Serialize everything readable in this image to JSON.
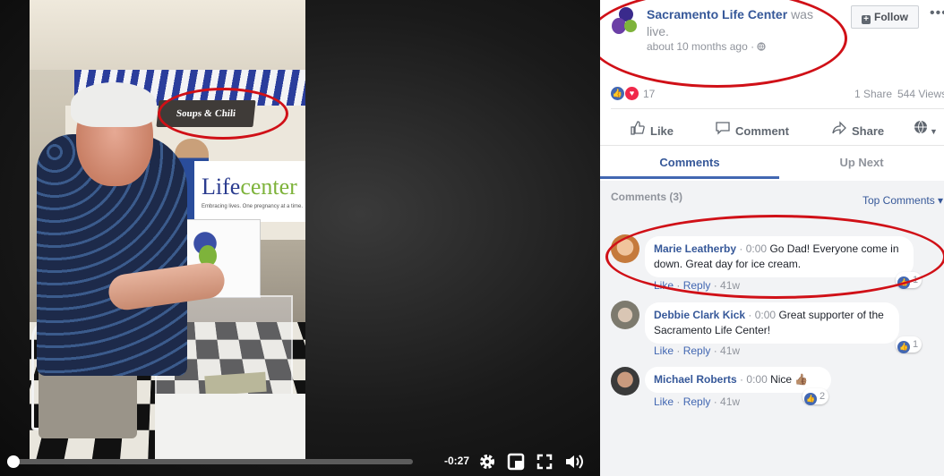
{
  "video": {
    "scene_text": {
      "store_sign": "Soups & Chili",
      "banner_logo_a": "Life",
      "banner_logo_b": "center",
      "banner_tagline": "Embracing lives. One pregnancy at a time."
    },
    "controls": {
      "progress": 0.0,
      "time_remaining": "-0:27",
      "icons": [
        "settings-icon",
        "theater-mode-icon",
        "fullscreen-icon",
        "volume-icon"
      ]
    }
  },
  "post": {
    "page_name": "Sacramento Life Center",
    "was_live_suffix": "was live.",
    "time_ago": "about 10 months ago",
    "audience_icon": "globe-icon",
    "follow_label": "Follow",
    "more_icon": "more-dots-icon",
    "reaction_count": "17",
    "shares": "1 Share",
    "views": "544 Views",
    "actions": {
      "like": "Like",
      "comment": "Comment",
      "share": "Share"
    }
  },
  "tabs": {
    "comments": "Comments",
    "up_next": "Up Next"
  },
  "comments_panel": {
    "count_label": "Comments (3)",
    "sort_label": "Top Comments ▾",
    "reply_label": "Reply",
    "like_label": "Like",
    "comments": [
      {
        "author": "Marie Leatherby",
        "timestamp": "0:00",
        "text": "Go Dad! Everyone come in down. Great day for ice cream.",
        "age": "41w",
        "likes": "1"
      },
      {
        "author": "Debbie Clark Kick",
        "timestamp": "0:00",
        "text": "Great supporter of the Sacramento Life Center!",
        "age": "41w",
        "likes": "1"
      },
      {
        "author": "Michael Roberts",
        "timestamp": "0:00",
        "text": "Nice 👍🏽",
        "age": "41w",
        "likes": "2"
      }
    ]
  },
  "colors": {
    "link": "#365899",
    "accent": "#4267b2",
    "annotation": "#d01017"
  }
}
